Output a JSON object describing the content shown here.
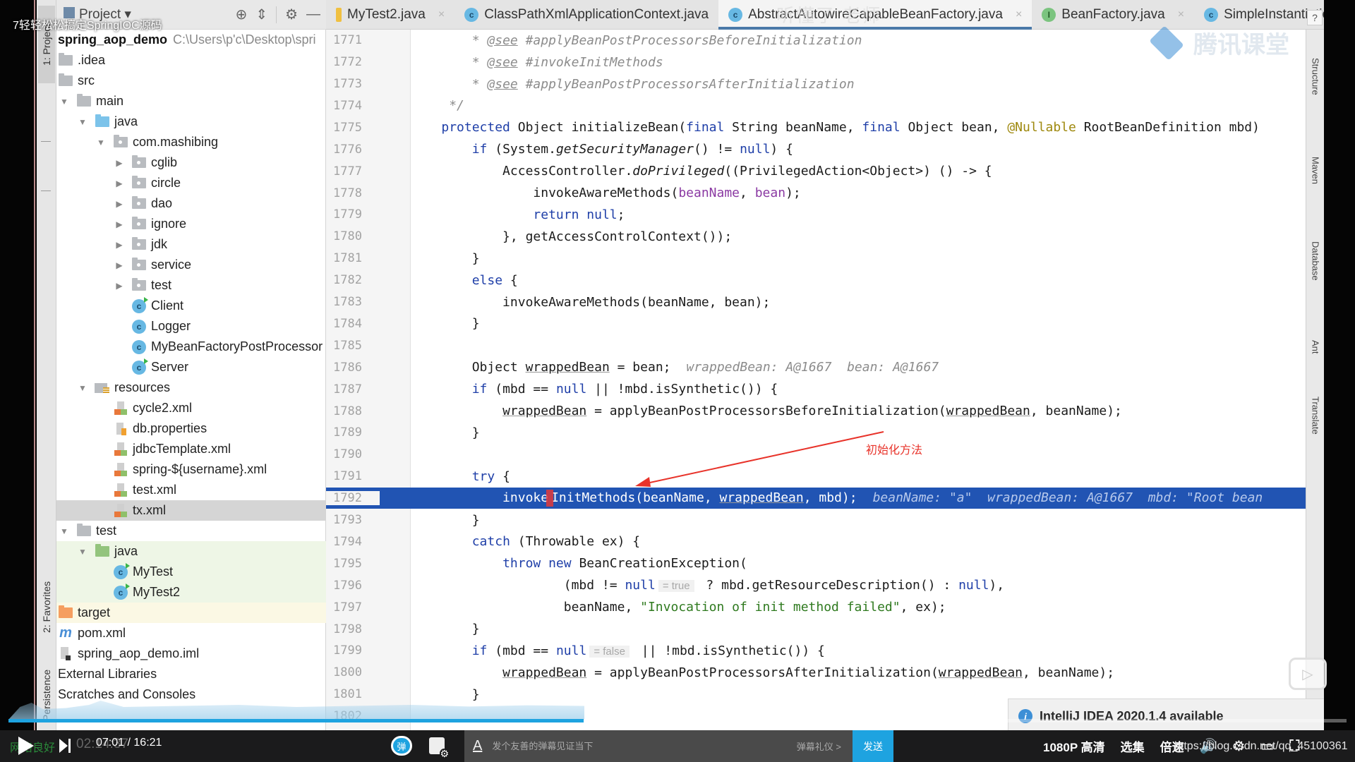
{
  "video": {
    "title": "7轻轻松松搞定SpringIOC源码",
    "danmaku_overlay": "听懂了  老师",
    "watermark_text": "腾讯课堂",
    "progress_percent": 43,
    "current_time": "07:01",
    "duration": "16:21",
    "time_separator": " / ",
    "ghost_time": "02:14:37",
    "network_status": "网络良好",
    "danmaku_toggle_label": "弹",
    "danmaku_placeholder": "发个友善的弹幕见证当下",
    "danmaku_etiquette": "弹幕礼仪 >",
    "send_label": "发送",
    "quality_label": "1080P 高清",
    "episodes_label": "选集",
    "speed_label": "倍速",
    "csdn_url": "https://blog.csdn.net/qq_45100361"
  },
  "ide": {
    "left_strip": {
      "project_tab": "1: Project",
      "favorites_tab": "2: Favorites",
      "persistence_tab": "Persistence"
    },
    "project_panel": {
      "header_label": "Project",
      "root_name": "spring_aop_demo",
      "root_path": "C:\\Users\\p'c\\Desktop\\spri",
      "items": [
        {
          "label": ".idea"
        },
        {
          "label": "src"
        },
        {
          "label": "main"
        },
        {
          "label": "java"
        },
        {
          "label": "com.mashibing"
        },
        {
          "label": "cglib"
        },
        {
          "label": "circle"
        },
        {
          "label": "dao"
        },
        {
          "label": "ignore"
        },
        {
          "label": "jdk"
        },
        {
          "label": "service"
        },
        {
          "label": "test"
        },
        {
          "label": "Client"
        },
        {
          "label": "Logger"
        },
        {
          "label": "MyBeanFactoryPostProcessor"
        },
        {
          "label": "Server"
        },
        {
          "label": "resources"
        },
        {
          "label": "cycle2.xml"
        },
        {
          "label": "db.properties"
        },
        {
          "label": "jdbcTemplate.xml"
        },
        {
          "label": "spring-${username}.xml"
        },
        {
          "label": "test.xml"
        },
        {
          "label": "tx.xml"
        },
        {
          "label": "test"
        },
        {
          "label": "java"
        },
        {
          "label": "MyTest"
        },
        {
          "label": "MyTest2"
        },
        {
          "label": "target"
        },
        {
          "label": "pom.xml"
        },
        {
          "label": "spring_aop_demo.iml"
        },
        {
          "label": "External Libraries"
        },
        {
          "label": "Scratches and Consoles"
        }
      ]
    },
    "tabs": [
      {
        "label": "MyTest2.java",
        "icon": "test-class-icon"
      },
      {
        "label": "ClassPathXmlApplicationContext.java",
        "icon": "class-icon"
      },
      {
        "label": "AbstractAutowireCapableBeanFactory.java",
        "icon": "class-icon",
        "active": true
      },
      {
        "label": "BeanFactory.java",
        "icon": "interface-icon"
      },
      {
        "label": "SimpleInstantiatio",
        "icon": "class-icon"
      }
    ],
    "class_icon_letter": "c",
    "interface_icon_letter": "I",
    "right_strip": [
      "Structure",
      "Maven",
      "Database",
      "Ant",
      "Translate"
    ],
    "help_label": "?",
    "annotation_label": "初始化方法",
    "notification": "IntelliJ IDEA 2020.1.4 available",
    "code": {
      "lines": [
        {
          "n": "1771",
          "seg": [
            [
              "tab",
              "* "
            ],
            [
              "tag",
              "@see"
            ],
            [
              "cm",
              " #applyBeanPostProcessorsBeforeInitialization"
            ]
          ]
        },
        {
          "n": "1772",
          "seg": [
            [
              "tab",
              "* "
            ],
            [
              "tag",
              "@see"
            ],
            [
              "cm",
              " #invokeInitMethods"
            ]
          ]
        },
        {
          "n": "1773",
          "seg": [
            [
              "tab",
              "* "
            ],
            [
              "tag",
              "@see"
            ],
            [
              "cm",
              " #applyBeanPostProcessorsAfterInitialization"
            ]
          ]
        },
        {
          "n": "1774",
          "seg": [
            [
              "cm",
              " */"
            ]
          ]
        },
        {
          "n": "1775",
          "seg": [
            [
              "kw",
              "protected"
            ],
            [
              "",
              " Object initializeBean("
            ],
            [
              "kw",
              "final"
            ],
            [
              "",
              " String beanName, "
            ],
            [
              "kw",
              "final"
            ],
            [
              "",
              " Object bean, "
            ],
            [
              "ann",
              "@Nullable"
            ],
            [
              "",
              " RootBeanDefinition mbd)"
            ]
          ]
        },
        {
          "n": "1776",
          "seg": [
            [
              "",
              "    "
            ],
            [
              "kw",
              "if"
            ],
            [
              "",
              " (System."
            ],
            [
              "it",
              "getSecurityManager"
            ],
            [
              "",
              "() != "
            ],
            [
              "kw",
              "null"
            ],
            [
              "",
              ") {"
            ]
          ]
        },
        {
          "n": "1777",
          "seg": [
            [
              "",
              "        AccessController."
            ],
            [
              "it",
              "doPrivileged"
            ],
            [
              "",
              "((PrivilegedAction<Object>) () -> {"
            ]
          ]
        },
        {
          "n": "1778",
          "seg": [
            [
              "",
              "            invokeAwareMethods("
            ],
            [
              "param",
              "beanName"
            ],
            [
              "",
              ", "
            ],
            [
              "param",
              "bean"
            ],
            [
              "",
              ");"
            ]
          ]
        },
        {
          "n": "1779",
          "seg": [
            [
              "",
              "            "
            ],
            [
              "kw",
              "return null"
            ],
            [
              "",
              ";"
            ]
          ]
        },
        {
          "n": "1780",
          "seg": [
            [
              "",
              "        }, getAccessControlContext());"
            ]
          ]
        },
        {
          "n": "1781",
          "seg": [
            [
              "",
              "    }"
            ]
          ]
        },
        {
          "n": "1782",
          "seg": [
            [
              "",
              "    "
            ],
            [
              "kw",
              "else"
            ],
            [
              "",
              " {"
            ]
          ]
        },
        {
          "n": "1783",
          "seg": [
            [
              "",
              "        invokeAwareMethods(beanName, bean);"
            ]
          ]
        },
        {
          "n": "1784",
          "seg": [
            [
              "",
              "    }"
            ]
          ]
        },
        {
          "n": "1785",
          "seg": []
        },
        {
          "n": "1786",
          "seg": [
            [
              "",
              "    Object "
            ],
            [
              "ul",
              "wrappedBean"
            ],
            [
              "",
              " = bean;"
            ],
            [
              "inlay",
              "wrappedBean: A@1667  bean: A@1667"
            ]
          ]
        },
        {
          "n": "1787",
          "seg": [
            [
              "",
              "    "
            ],
            [
              "kw",
              "if"
            ],
            [
              "",
              " (mbd == "
            ],
            [
              "kw",
              "null"
            ],
            [
              "",
              " || !mbd.isSynthetic()) {"
            ]
          ]
        },
        {
          "n": "1788",
          "seg": [
            [
              "",
              "        "
            ],
            [
              "ul",
              "wrappedBean"
            ],
            [
              "",
              " = applyBeanPostProcessorsBeforeInitialization("
            ],
            [
              "ul",
              "wrappedBean"
            ],
            [
              "",
              ", beanName);"
            ]
          ]
        },
        {
          "n": "1789",
          "seg": [
            [
              "",
              "    }"
            ]
          ]
        },
        {
          "n": "1790",
          "seg": []
        },
        {
          "n": "1791",
          "seg": [
            [
              "",
              "    "
            ],
            [
              "kw",
              "try"
            ],
            [
              "",
              " {"
            ]
          ]
        },
        {
          "n": "1792",
          "exec": true,
          "seg": [
            [
              "",
              "        invoke"
            ],
            [
              "caret",
              ""
            ],
            [
              "",
              "InitMethods(beanName, "
            ],
            [
              "ul",
              "wrappedBean"
            ],
            [
              "",
              ", mbd);"
            ],
            [
              "inlay",
              "beanName: \"a\"  wrappedBean: A@1667  mbd: \"Root bean"
            ]
          ]
        },
        {
          "n": "1793",
          "seg": [
            [
              "",
              "    }"
            ]
          ]
        },
        {
          "n": "1794",
          "seg": [
            [
              "",
              "    "
            ],
            [
              "kw",
              "catch"
            ],
            [
              "",
              " (Throwable ex) {"
            ]
          ]
        },
        {
          "n": "1795",
          "seg": [
            [
              "",
              "        "
            ],
            [
              "kw",
              "throw new"
            ],
            [
              "",
              " BeanCreationException("
            ]
          ]
        },
        {
          "n": "1796",
          "seg": [
            [
              "",
              "                (mbd != "
            ],
            [
              "kw",
              "null"
            ],
            [
              "pill",
              "= true"
            ],
            [
              "",
              " ? mbd.getResourceDescription() : "
            ],
            [
              "kw",
              "null"
            ],
            [
              "",
              "),"
            ]
          ]
        },
        {
          "n": "1797",
          "seg": [
            [
              "",
              "                beanName, "
            ],
            [
              "str",
              "\"Invocation of init method failed\""
            ],
            [
              "",
              ", ex);"
            ]
          ]
        },
        {
          "n": "1798",
          "seg": [
            [
              "",
              "    }"
            ]
          ]
        },
        {
          "n": "1799",
          "seg": [
            [
              "",
              "    "
            ],
            [
              "kw",
              "if"
            ],
            [
              "",
              " (mbd == "
            ],
            [
              "kw",
              "null"
            ],
            [
              "pill",
              "= false"
            ],
            [
              "",
              " || !mbd.isSynthetic()) {"
            ]
          ]
        },
        {
          "n": "1800",
          "seg": [
            [
              "",
              "        "
            ],
            [
              "ul",
              "wrappedBean"
            ],
            [
              "",
              " = applyBeanPostProcessorsAfterInitialization("
            ],
            [
              "ul",
              "wrappedBean"
            ],
            [
              "",
              ", beanName);"
            ]
          ]
        },
        {
          "n": "1801",
          "seg": [
            [
              "",
              "    }"
            ]
          ]
        },
        {
          "n": "1802",
          "seg": []
        }
      ]
    }
  }
}
